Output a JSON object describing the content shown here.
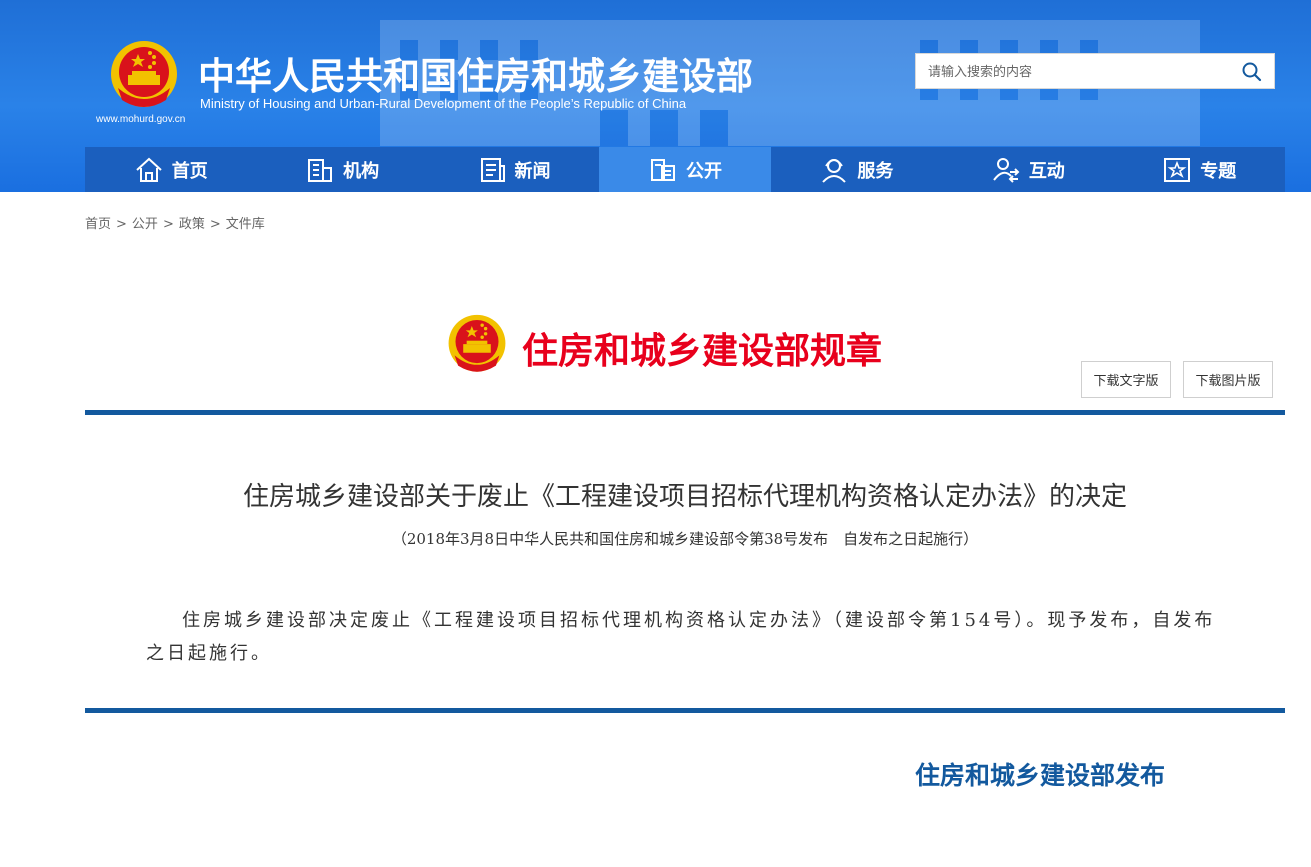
{
  "header": {
    "site_url": "www.mohurd.gov.cn",
    "title_cn": "中华人民共和国住房和城乡建设部",
    "title_en": "Ministry of Housing and Urban-Rural Development of the People’s Republic of China"
  },
  "search": {
    "placeholder": "请输入搜索的内容"
  },
  "nav": {
    "items": [
      {
        "label": "首页",
        "icon": "home-icon"
      },
      {
        "label": "机构",
        "icon": "building-icon"
      },
      {
        "label": "新闻",
        "icon": "news-icon"
      },
      {
        "label": "公开",
        "icon": "disclosure-icon"
      },
      {
        "label": "服务",
        "icon": "service-icon"
      },
      {
        "label": "互动",
        "icon": "interaction-icon"
      },
      {
        "label": "专题",
        "icon": "topic-icon"
      }
    ],
    "active_index": 3
  },
  "breadcrumb": {
    "items": [
      "首页",
      "公开",
      "政策",
      "文件库"
    ],
    "separator": ">"
  },
  "document": {
    "type_label": "住房和城乡建设部规章",
    "download_text_label": "下载文字版",
    "download_image_label": "下载图片版",
    "title": "住房城乡建设部关于废止《工程建设项目招标代理机构资格认定办法》的决定",
    "subtitle": "（2018年3月8日中华人民共和国住房和城乡建设部令第38号发布　自发布之日起施行）",
    "body": "住房城乡建设部决定废止《工程建设项目招标代理机构资格认定办法》（建设部令第154号）。现予发布，自发布之日起施行。",
    "issuer": "住房和城乡建设部发布"
  },
  "colors": {
    "header_blue": "#1f6fd6",
    "nav_bg": "#1b5fbe",
    "nav_active": "#3a8ae8",
    "rule_blue": "#13599e",
    "type_red": "#e8001c"
  }
}
